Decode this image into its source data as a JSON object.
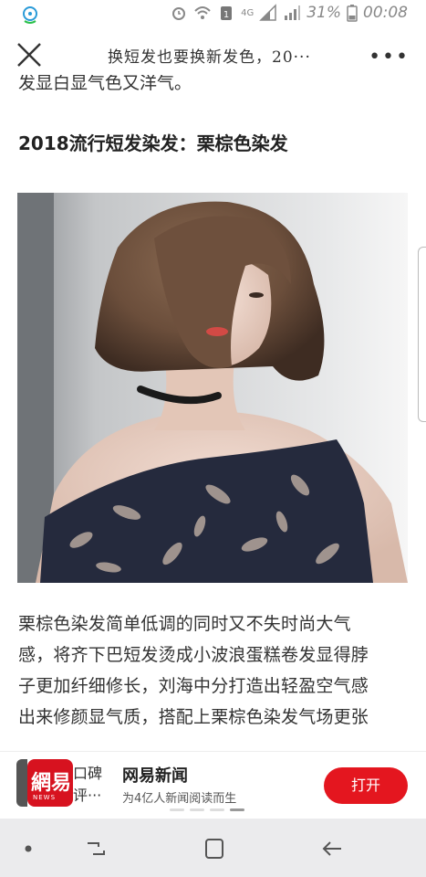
{
  "status_bar": {
    "battery_percent": "31%",
    "time": "00:08",
    "network": "4G"
  },
  "nav": {
    "title": "换短发也要换新发色，20···",
    "more": "•••"
  },
  "article": {
    "prev_line": "发显白显气色又洋气。",
    "heading": "2018流行短发染发：栗棕色染发",
    "paragraph_lines": [
      "栗棕色染发简单低调的同时又不失时尚大气",
      "感，将齐下巴短发烫成小波浪蛋糕卷发显得脖",
      "子更加纤细修长，刘海中分打造出轻盈空气感",
      "出来修颜显气质，搭配上栗棕色染发气场更张"
    ]
  },
  "banner": {
    "logo_cn": "網易",
    "logo_en": "NEWS",
    "prev_text_line1": "口碑",
    "prev_text_line2": "评···",
    "app_name": "网易新闻",
    "app_sub": "为4亿人新闻阅读而生",
    "open_label": "打开",
    "carousel_active_index": 3
  },
  "colors": {
    "brand_red": "#e4161f",
    "logo_red": "#d7121f"
  },
  "icons": {
    "status_left": "assistant-icon",
    "close": "close-icon",
    "nav_back": "back-icon",
    "nav_home": "home-icon",
    "nav_recents": "recents-icon"
  }
}
